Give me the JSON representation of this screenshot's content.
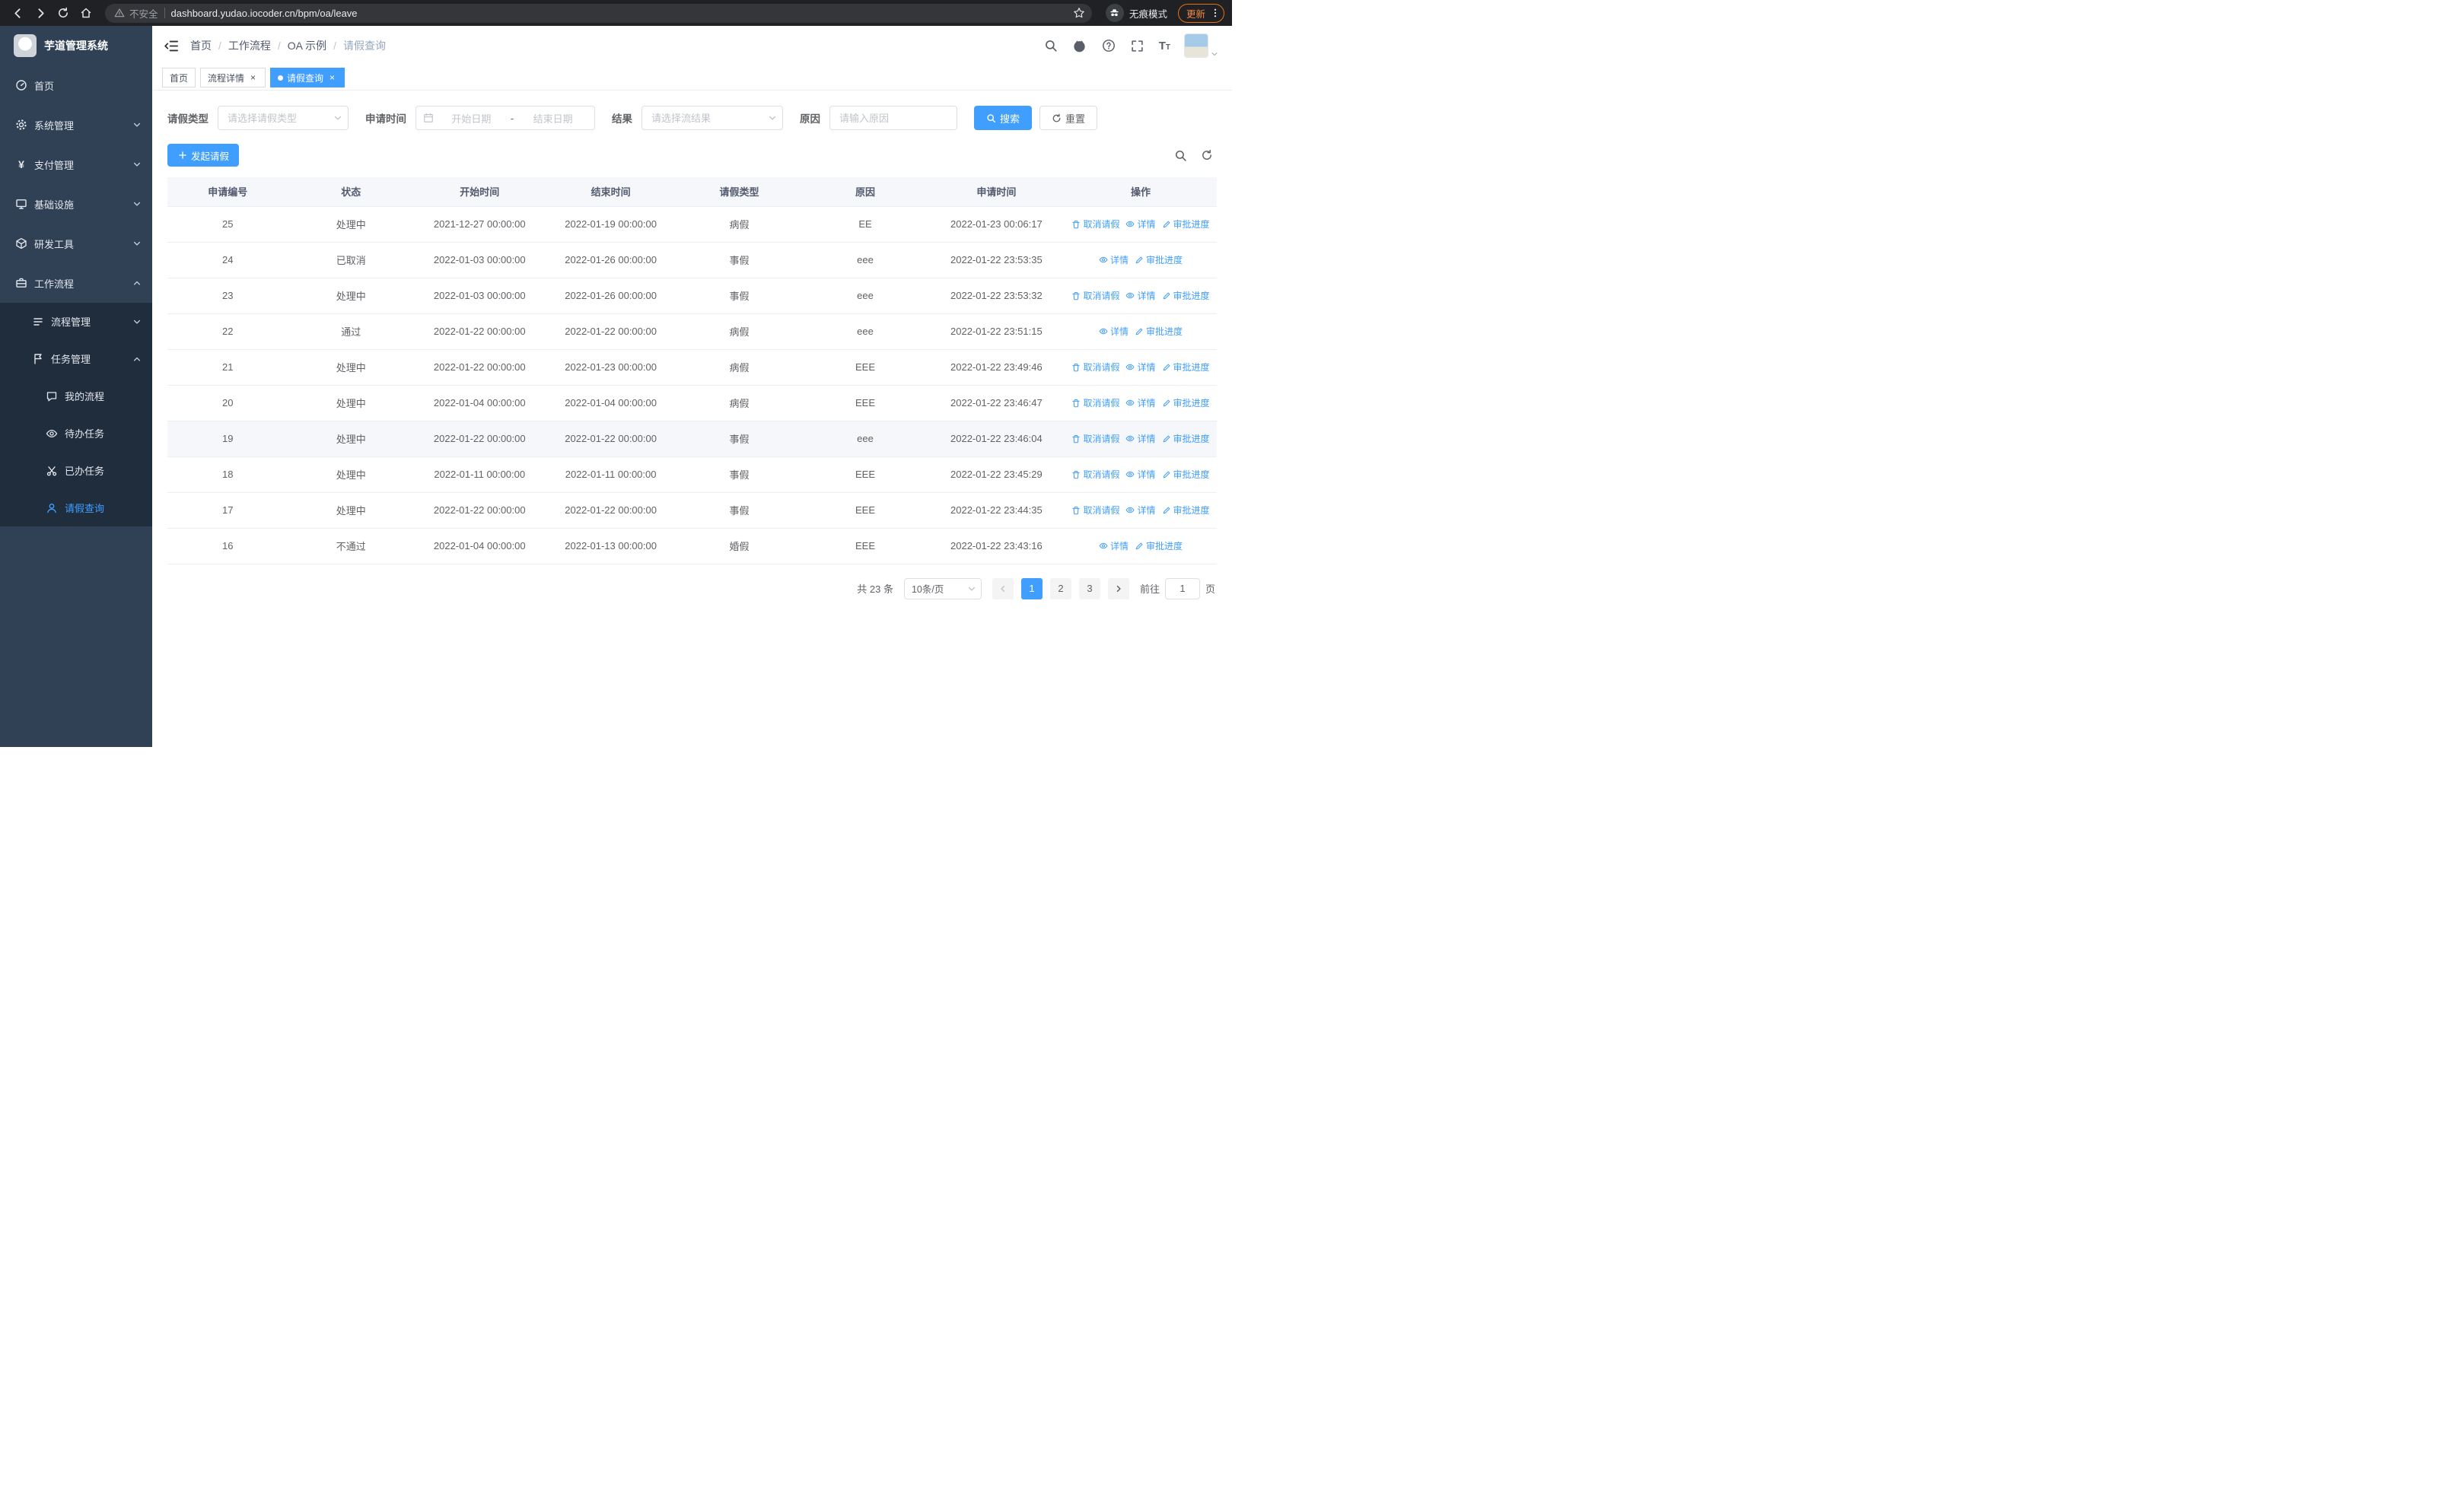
{
  "browser": {
    "url": "dashboard.yudao.iocoder.cn/bpm/oa/leave",
    "security_label": "不安全",
    "incognito_label": "无痕模式",
    "update_label": "更新"
  },
  "sidebar": {
    "title": "芋道管理系统",
    "items": [
      {
        "label": "首页",
        "icon": "dashboard-icon",
        "level": 1
      },
      {
        "label": "系统管理",
        "icon": "gear-icon",
        "level": 1,
        "chevron": "down"
      },
      {
        "label": "支付管理",
        "icon": "yen-icon",
        "level": 1,
        "chevron": "down"
      },
      {
        "label": "基础设施",
        "icon": "infra-icon",
        "level": 1,
        "chevron": "down"
      },
      {
        "label": "研发工具",
        "icon": "tools-icon",
        "level": 1,
        "chevron": "down"
      },
      {
        "label": "工作流程",
        "icon": "workflow-icon",
        "level": 1,
        "chevron": "up"
      },
      {
        "label": "流程管理",
        "icon": "process-icon",
        "level": 2,
        "chevron": "down"
      },
      {
        "label": "任务管理",
        "icon": "task-icon",
        "level": 2,
        "chevron": "up"
      },
      {
        "label": "我的流程",
        "icon": "chat-icon",
        "level": 3
      },
      {
        "label": "待办任务",
        "icon": "eye-icon",
        "level": 3
      },
      {
        "label": "已办任务",
        "icon": "done-icon",
        "level": 3
      },
      {
        "label": "请假查询",
        "icon": "user-icon",
        "level": 3,
        "active": true
      }
    ]
  },
  "header": {
    "breadcrumb": [
      "首页",
      "工作流程",
      "OA 示例",
      "请假查询"
    ]
  },
  "tabs": [
    {
      "label": "首页",
      "closable": false,
      "active": false
    },
    {
      "label": "流程详情",
      "closable": true,
      "active": false
    },
    {
      "label": "请假查询",
      "closable": true,
      "active": true
    }
  ],
  "filters": {
    "leave_type_label": "请假类型",
    "leave_type_placeholder": "请选择请假类型",
    "apply_time_label": "申请时间",
    "start_date_placeholder": "开始日期",
    "range_separator": "-",
    "end_date_placeholder": "结束日期",
    "result_label": "结果",
    "result_placeholder": "请选择流结果",
    "reason_label": "原因",
    "reason_placeholder": "请输入原因",
    "search_label": "搜索",
    "reset_label": "重置"
  },
  "toolbar": {
    "create_label": "发起请假"
  },
  "table": {
    "columns": [
      "申请编号",
      "状态",
      "开始时间",
      "结束时间",
      "请假类型",
      "原因",
      "申请时间",
      "操作"
    ],
    "action_labels": {
      "cancel": "取消请假",
      "detail": "详情",
      "progress": "审批进度"
    },
    "rows": [
      {
        "no": "25",
        "status": "处理中",
        "start": "2021-12-27 00:00:00",
        "end": "2022-01-19 00:00:00",
        "type": "病假",
        "reason": "EE",
        "apply_time": "2022-01-23 00:06:17",
        "cancelable": true,
        "hover": false
      },
      {
        "no": "24",
        "status": "已取消",
        "start": "2022-01-03 00:00:00",
        "end": "2022-01-26 00:00:00",
        "type": "事假",
        "reason": "eee",
        "apply_time": "2022-01-22 23:53:35",
        "cancelable": false,
        "hover": false
      },
      {
        "no": "23",
        "status": "处理中",
        "start": "2022-01-03 00:00:00",
        "end": "2022-01-26 00:00:00",
        "type": "事假",
        "reason": "eee",
        "apply_time": "2022-01-22 23:53:32",
        "cancelable": true,
        "hover": false
      },
      {
        "no": "22",
        "status": "通过",
        "start": "2022-01-22 00:00:00",
        "end": "2022-01-22 00:00:00",
        "type": "病假",
        "reason": "eee",
        "apply_time": "2022-01-22 23:51:15",
        "cancelable": false,
        "hover": false
      },
      {
        "no": "21",
        "status": "处理中",
        "start": "2022-01-22 00:00:00",
        "end": "2022-01-23 00:00:00",
        "type": "病假",
        "reason": "EEE",
        "apply_time": "2022-01-22 23:49:46",
        "cancelable": true,
        "hover": false
      },
      {
        "no": "20",
        "status": "处理中",
        "start": "2022-01-04 00:00:00",
        "end": "2022-01-04 00:00:00",
        "type": "病假",
        "reason": "EEE",
        "apply_time": "2022-01-22 23:46:47",
        "cancelable": true,
        "hover": false
      },
      {
        "no": "19",
        "status": "处理中",
        "start": "2022-01-22 00:00:00",
        "end": "2022-01-22 00:00:00",
        "type": "事假",
        "reason": "eee",
        "apply_time": "2022-01-22 23:46:04",
        "cancelable": true,
        "hover": true
      },
      {
        "no": "18",
        "status": "处理中",
        "start": "2022-01-11 00:00:00",
        "end": "2022-01-11 00:00:00",
        "type": "事假",
        "reason": "EEE",
        "apply_time": "2022-01-22 23:45:29",
        "cancelable": true,
        "hover": false
      },
      {
        "no": "17",
        "status": "处理中",
        "start": "2022-01-22 00:00:00",
        "end": "2022-01-22 00:00:00",
        "type": "事假",
        "reason": "EEE",
        "apply_time": "2022-01-22 23:44:35",
        "cancelable": true,
        "hover": false
      },
      {
        "no": "16",
        "status": "不通过",
        "start": "2022-01-04 00:00:00",
        "end": "2022-01-13 00:00:00",
        "type": "婚假",
        "reason": "EEE",
        "apply_time": "2022-01-22 23:43:16",
        "cancelable": false,
        "hover": false
      }
    ]
  },
  "pagination": {
    "total_label": "共 23 条",
    "page_size_label": "10条/页",
    "pages": [
      "1",
      "2",
      "3"
    ],
    "active_page": "1",
    "goto_label": "前往",
    "goto_value": "1",
    "page_unit_label": "页"
  }
}
